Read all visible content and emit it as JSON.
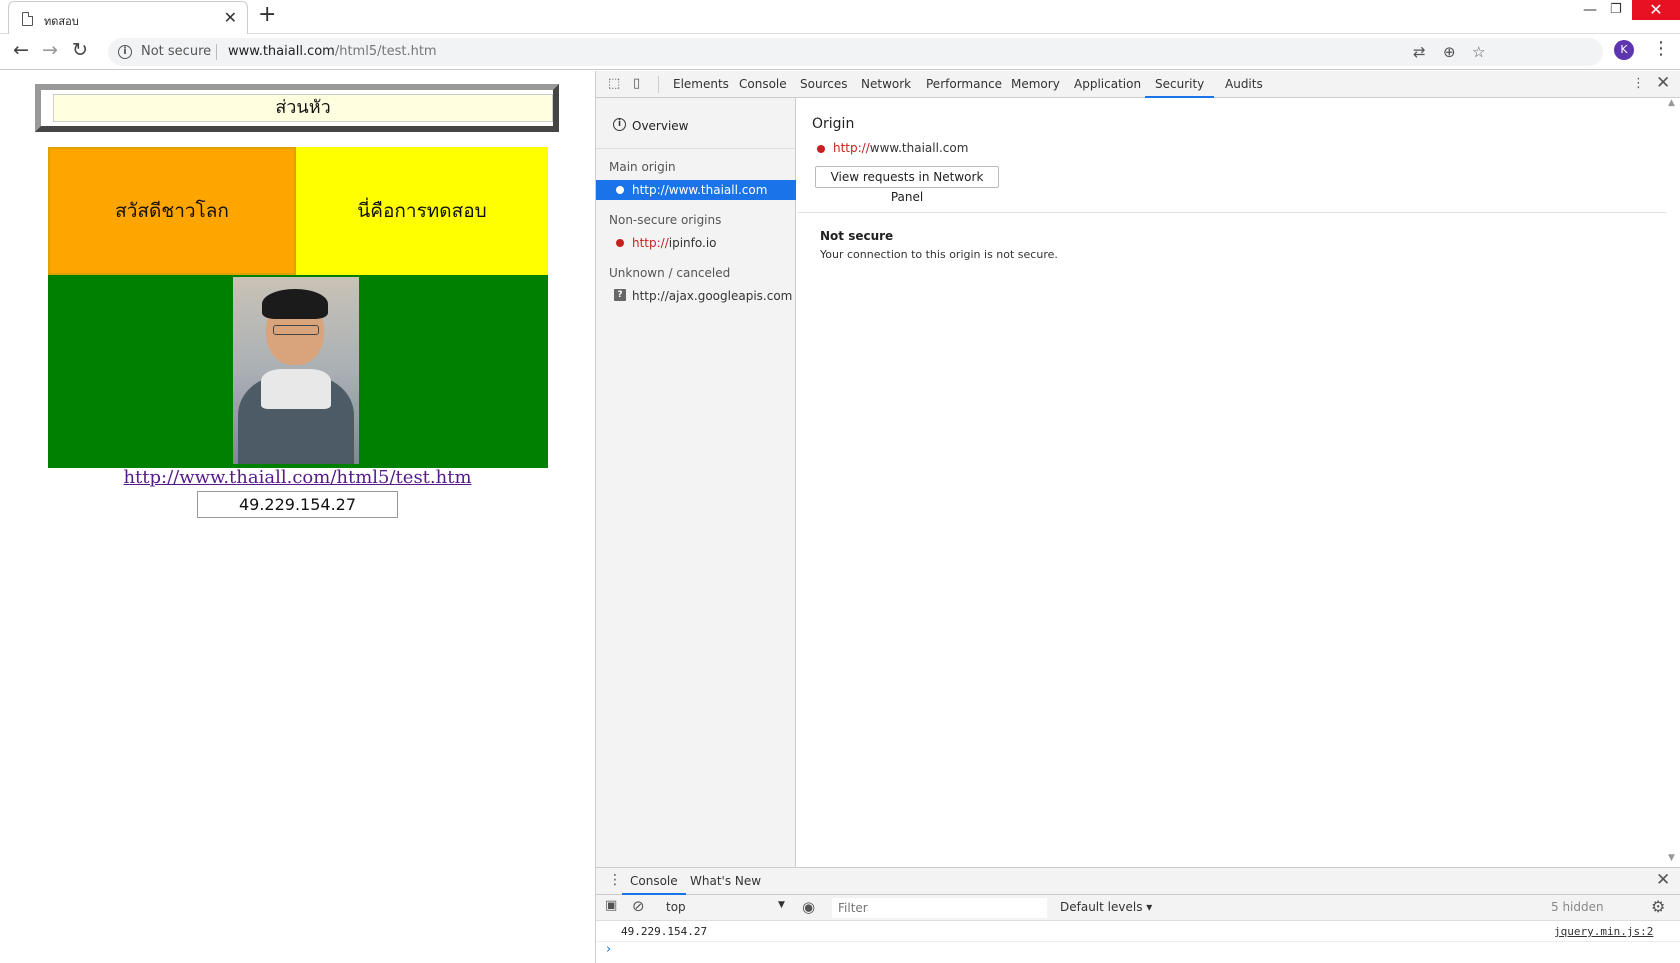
{
  "browser": {
    "tab_title": "ทดสอบ",
    "tab_close": "✕",
    "new_tab": "+",
    "window_controls": {
      "minimize": "—",
      "maximize": "❐",
      "close": "✕"
    },
    "nav": {
      "back": "←",
      "forward": "→",
      "reload": "↻"
    },
    "security_label": "Not secure",
    "url_host": "www.thaiall.com",
    "url_path": "/html5/test.htm",
    "icons": {
      "translate": "⇄",
      "zoom": "⊕",
      "bookmark": "☆"
    },
    "avatar_letter": "K",
    "menu": "⋮"
  },
  "page": {
    "header": "ส่วนหัว",
    "cell_left": "สวัสดีชาวโลก",
    "cell_right": "นี่คือการทดสอบ",
    "link": "http://www.thaiall.com/html5/test.htm",
    "ip": "49.229.154.27",
    "colors": {
      "left_cell": "#ffa500",
      "right_cell": "#ffff00",
      "photo_cell": "#008000",
      "header_bg": "#ffffe0"
    }
  },
  "devtools": {
    "tools": {
      "inspect": "⬚",
      "device": "▯"
    },
    "tabs": [
      "Elements",
      "Console",
      "Sources",
      "Network",
      "Performance",
      "Memory",
      "Application",
      "Security",
      "Audits"
    ],
    "active_tab": "Security",
    "more": "⋮",
    "close": "✕",
    "security": {
      "overview_label": "Overview",
      "overview_icon": "i",
      "main_origin_heading": "Main origin",
      "main_origin": {
        "scheme": "http://",
        "host": "www.thaiall.com"
      },
      "non_secure_heading": "Non-secure origins",
      "non_secure_origin": {
        "scheme": "http://",
        "host": "ipinfo.io"
      },
      "unknown_heading": "Unknown / canceled",
      "unknown_icon": "?",
      "unknown_origin": "http://ajax.googleapis.com",
      "origin_title": "Origin",
      "origin_url": {
        "scheme": "http://",
        "host": "www.thaiall.com"
      },
      "view_requests_button": "View requests in Network Panel",
      "not_secure_title": "Not secure",
      "not_secure_desc": "Your connection to this origin is not secure.",
      "insecure_color": "#c5221f",
      "selected_color": "#1a73e8"
    },
    "drawer": {
      "menu": "⋮",
      "tabs": [
        "Console",
        "What's New"
      ],
      "close": "✕",
      "sidebar_toggle": "▣",
      "clear": "⊘",
      "context": "top",
      "context_arrow": "▼",
      "eye": "◉",
      "filter_placeholder": "Filter",
      "levels": "Default levels ▾",
      "hidden": "5 hidden",
      "gear": "⚙",
      "log_text": "49.229.154.27",
      "log_source": "jquery.min.js:2",
      "prompt": "›"
    }
  }
}
